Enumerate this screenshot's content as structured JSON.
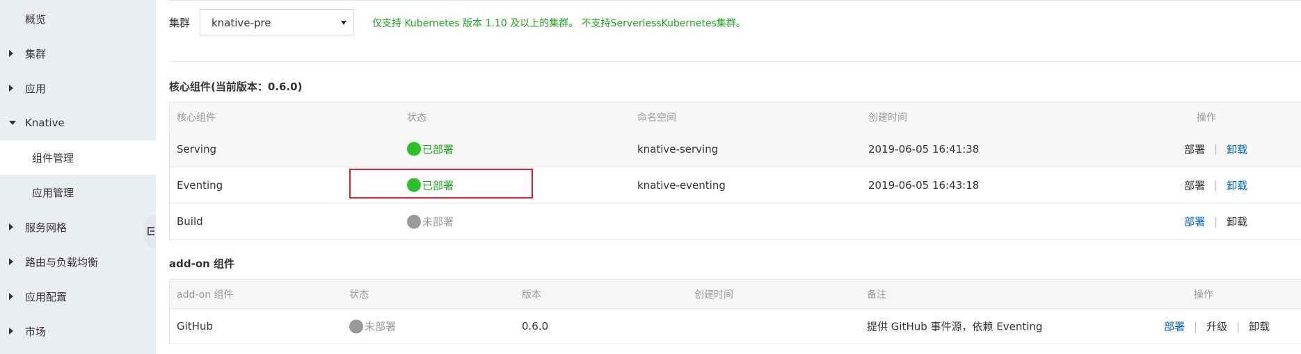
{
  "sidebar": {
    "items": [
      {
        "label": "概览"
      },
      {
        "label": "集群"
      },
      {
        "label": "应用"
      },
      {
        "label": "Knative"
      },
      {
        "label": "组件管理"
      },
      {
        "label": "应用管理"
      },
      {
        "label": "服务网格"
      },
      {
        "label": "路由与负载均衡"
      },
      {
        "label": "应用配置"
      },
      {
        "label": "市场"
      }
    ]
  },
  "filter": {
    "cluster_label": "集群",
    "cluster_value": "knative-pre",
    "notice": "仅支持 Kubernetes 版本 1.10 及以上的集群。 不支持ServerlessKubernetes集群。"
  },
  "core": {
    "title": "核心组件(当前版本：0.6.0)",
    "headers": [
      "核心组件",
      "状态",
      "命名空间",
      "创建时间",
      "操作"
    ],
    "rows": [
      {
        "name": "Serving",
        "status": "已部署",
        "namespace": "knative-serving",
        "created": "2019-06-05 16:41:38",
        "deploy": "部署",
        "uninstall": "卸载"
      },
      {
        "name": "Eventing",
        "status": "已部署",
        "namespace": "knative-eventing",
        "created": "2019-06-05 16:43:18",
        "deploy": "部署",
        "uninstall": "卸载"
      },
      {
        "name": "Build",
        "status": "未部署",
        "namespace": "",
        "created": "",
        "deploy": "部署",
        "uninstall": "卸载"
      }
    ]
  },
  "addon": {
    "title": "add-on 组件",
    "headers": [
      "add-on 组件",
      "状态",
      "版本",
      "创建时间",
      "备注",
      "操作"
    ],
    "rows": [
      {
        "name": "GitHub",
        "status": "未部署",
        "version": "0.6.0",
        "created": "",
        "note": "提供 GitHub 事件源，依赖 Eventing",
        "deploy": "部署",
        "upgrade": "升级",
        "uninstall": "卸载"
      }
    ]
  },
  "colors": {
    "deployed": "#2bc12b",
    "not_deployed": "#999999",
    "link": "#0066cc",
    "highlight": "#e0212b"
  }
}
